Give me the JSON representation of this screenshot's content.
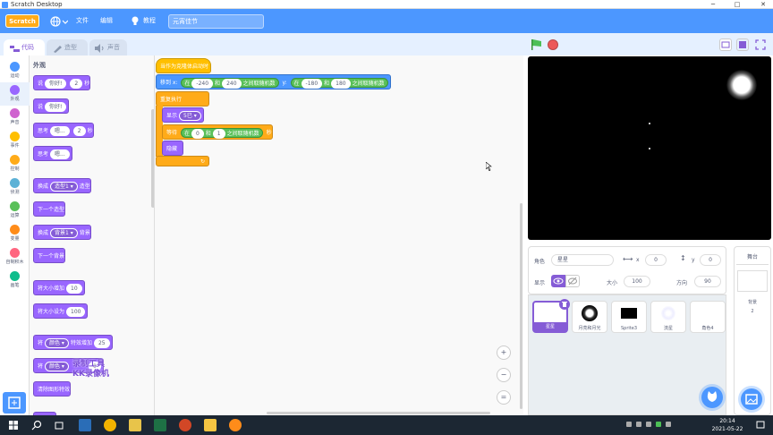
{
  "window": {
    "title": "Scratch Desktop",
    "min": "─",
    "max": "□",
    "close": "✕"
  },
  "menubar": {
    "logo": "Scratch",
    "file": "文件",
    "edit": "编辑",
    "tutorial": "教程",
    "project_title": "元宵佳节"
  },
  "tabs": {
    "code": "代码",
    "costumes": "造型",
    "sounds": "声音"
  },
  "categories": [
    {
      "label": "运动",
      "color": "#4c97ff"
    },
    {
      "label": "外观",
      "color": "#9966ff"
    },
    {
      "label": "声音",
      "color": "#cf63cf"
    },
    {
      "label": "事件",
      "color": "#ffbf00"
    },
    {
      "label": "控制",
      "color": "#ffab19"
    },
    {
      "label": "侦测",
      "color": "#5cb1d6"
    },
    {
      "label": "运算",
      "color": "#59c059"
    },
    {
      "label": "变量",
      "color": "#ff8c1a"
    },
    {
      "label": "自制积木",
      "color": "#ff6680"
    },
    {
      "label": "画笔",
      "color": "#0fbd8c"
    }
  ],
  "palette": {
    "section": "外观",
    "say_secs": {
      "a": "说",
      "b": "你好!",
      "c": "2",
      "d": "秒"
    },
    "say": {
      "a": "说",
      "b": "你好!"
    },
    "think_secs": {
      "a": "思考",
      "b": "嗯...",
      "c": "2",
      "d": "秒"
    },
    "think": {
      "a": "思考",
      "b": "嗯..."
    },
    "switch_costume": {
      "a": "换成",
      "b": "造型1 ▾",
      "c": "造型"
    },
    "next_costume": "下一个造型",
    "switch_backdrop": {
      "a": "换成",
      "b": "背景1 ▾",
      "c": "背景"
    },
    "next_backdrop": "下一个背景",
    "change_size": {
      "a": "将大小增加",
      "b": "10"
    },
    "set_size": {
      "a": "将大小设为",
      "b": "100"
    },
    "change_effect": {
      "a": "将",
      "b": "颜色 ▾",
      "c": "特效增加",
      "d": "25"
    },
    "set_effect": {
      "a": "将",
      "b": "颜色 ▾",
      "c": "0"
    },
    "clear_effects": "清除图形特效"
  },
  "script": {
    "hat": "当作为克隆体启动时",
    "goto": {
      "a": "移到 x:",
      "b": "在",
      "c": "-240",
      "d": "和",
      "e": "240",
      "f": "之间取随机数",
      "g": "y:",
      "h": "在",
      "i": "-180",
      "j": "和",
      "k": "180",
      "l": "之间取随机数"
    },
    "forever": "重复执行",
    "show_prefix": "显示",
    "show_text": "5已 ▾",
    "wait": {
      "a": "等待",
      "b": "在",
      "c": "0",
      "d": "和",
      "e": "1",
      "f": "之间取随机数",
      "g": "秒"
    },
    "hide": "隐藏",
    "loop_arrow": "↻"
  },
  "watermark": {
    "line1": "录制工具",
    "line2": "KK录像机"
  },
  "zoom": {
    "in": "+",
    "out": "−",
    "reset": "="
  },
  "sprite_info": {
    "sprite_label": "角色",
    "sprite_name": "星星",
    "x_label": "x",
    "x_value": "0",
    "y_label": "y",
    "y_value": "0",
    "show_label": "显示",
    "size_label": "大小",
    "size_value": "100",
    "direction_label": "方向",
    "direction_value": "90"
  },
  "sprites": [
    "星星",
    "月亮和月光",
    "Sprite3",
    "流星",
    "角色4"
  ],
  "stage_panel": {
    "title": "舞台",
    "backdrops_label": "背景",
    "backdrops_count": "2"
  },
  "taskbar": {
    "time": "20:14",
    "date": "2021-05-22"
  }
}
